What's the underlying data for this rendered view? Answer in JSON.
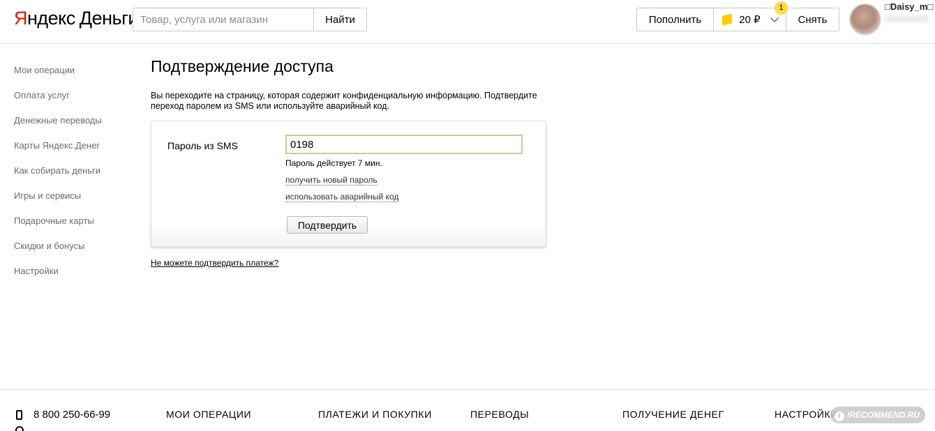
{
  "header": {
    "logo": {
      "y": "Я",
      "rest": "ндекс",
      "product": "Деньги"
    },
    "search": {
      "placeholder": "Товар, услуга или магазин",
      "button_label": "Найти"
    },
    "wallet": {
      "topup_label": "Пополнить",
      "balance": "20 ₽",
      "badge_count": "1",
      "withdraw_label": "Снять"
    },
    "user": {
      "name": "□Daisy_m□"
    }
  },
  "sidebar": {
    "items": [
      {
        "label": "Мои операции"
      },
      {
        "label": "Оплата услуг"
      },
      {
        "label": "Денежные переводы"
      },
      {
        "label": "Карты Яндекс.Денег"
      },
      {
        "label": "Как собирать деньги"
      },
      {
        "label": "Игры и сервисы"
      },
      {
        "label": "Подарочные карты"
      },
      {
        "label": "Скидки и бонусы"
      },
      {
        "label": "Настройки"
      }
    ]
  },
  "main": {
    "title": "Подтверждение доступа",
    "description": "Вы переходите на страницу, которая содержит конфиденциальную информацию. Подтвердите переход паролем из SMS или используйте аварийный код.",
    "form": {
      "password_label": "Пароль из SMS",
      "password_value": "0198",
      "hint": "Пароль действует  7 мин.",
      "new_password_link": "получить новый пароль",
      "emergency_code_link": "использовать аварийный код",
      "confirm_button": "Подтвердить"
    },
    "cant_confirm_link": "Не можете подтвердить платеж?"
  },
  "footer": {
    "phone": "8 800 250-66-99",
    "nav": [
      "МОИ ОПЕРАЦИИ",
      "ПЛАТЕЖИ И ПОКУПКИ",
      "ПЕРЕВОДЫ",
      "ПОЛУЧЕНИЕ ДЕНЕГ",
      "НАСТРОЙКИ"
    ]
  },
  "watermark": "IRECOMMEND.RU",
  "colors": {
    "logo_red": "#e61400",
    "badge_yellow": "#ffdb4d",
    "wallet_icon": "#ffcc00",
    "input_focus_border": "#ddc57a"
  },
  "icons": {
    "wallet": "wallet-icon",
    "balance_dropdown": "chevron-down-icon",
    "phone": "phone-icon",
    "help": "help-icon"
  }
}
